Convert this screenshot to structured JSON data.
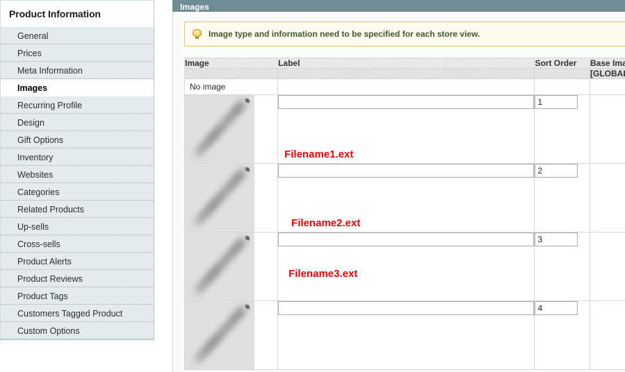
{
  "sidebar": {
    "title": "Product Information",
    "items": [
      {
        "label": "General",
        "active": false
      },
      {
        "label": "Prices",
        "active": false
      },
      {
        "label": "Meta Information",
        "active": false
      },
      {
        "label": "Images",
        "active": true
      },
      {
        "label": "Recurring Profile",
        "active": false
      },
      {
        "label": "Design",
        "active": false
      },
      {
        "label": "Gift Options",
        "active": false
      },
      {
        "label": "Inventory",
        "active": false
      },
      {
        "label": "Websites",
        "active": false
      },
      {
        "label": "Categories",
        "active": false
      },
      {
        "label": "Related Products",
        "active": false
      },
      {
        "label": "Up-sells",
        "active": false
      },
      {
        "label": "Cross-sells",
        "active": false
      },
      {
        "label": "Product Alerts",
        "active": false
      },
      {
        "label": "Product Reviews",
        "active": false
      },
      {
        "label": "Product Tags",
        "active": false
      },
      {
        "label": "Customers Tagged Product",
        "active": false
      },
      {
        "label": "Custom Options",
        "active": false
      }
    ]
  },
  "panel": {
    "header_title": "Images",
    "notice": {
      "icon": "lightbulb-icon",
      "text": "Image type and information need to be specified for each store view."
    }
  },
  "table": {
    "headers": {
      "image": "Image",
      "label": "Label",
      "sort_order": "Sort Order",
      "base_image": "Base Image",
      "base_image_scope": "[GLOBAL]"
    },
    "no_image_row": {
      "text": "No image",
      "base_image_selected": false
    },
    "rows": [
      {
        "thumbnail": "image-thumbnail",
        "label_value": "",
        "label_placeholder": "",
        "filename": "Filename1.ext",
        "sort_order": "1",
        "base_image_selected": true
      },
      {
        "thumbnail": "image-thumbnail",
        "label_value": "",
        "label_placeholder": "",
        "filename": "Filename2.ext",
        "sort_order": "2",
        "base_image_selected": false
      },
      {
        "thumbnail": "image-thumbnail",
        "label_value": "",
        "label_placeholder": "",
        "filename": "Filename3.ext",
        "sort_order": "3",
        "base_image_selected": false
      },
      {
        "thumbnail": "image-thumbnail",
        "label_value": "",
        "label_placeholder": "",
        "filename": "",
        "sort_order": "4",
        "base_image_selected": false
      }
    ]
  },
  "colors": {
    "panel_header": "#6f8c95",
    "sidebar_item_bg": "#e3ecea",
    "notice_bg": "#fffcef",
    "notice_border": "#e0c56c",
    "notice_text": "#3c5a2c",
    "filename_text": "#f20000",
    "table_header_bg": "#e3e3e3"
  }
}
